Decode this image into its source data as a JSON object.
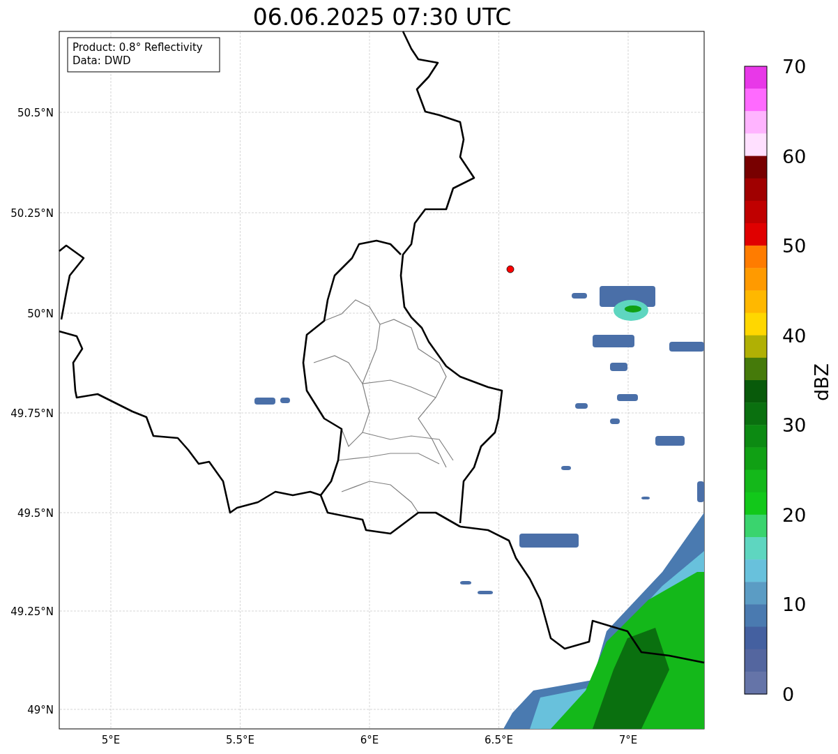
{
  "title": "06.06.2025 07:30 UTC",
  "info_box": {
    "lines": [
      "Product: 0.8° Reflectivity",
      "Data: DWD"
    ]
  },
  "lat_labels": [
    "50.5°N",
    "50.25°N",
    "50°N",
    "49.75°N",
    "49.5°N",
    "49.25°N",
    "49°N"
  ],
  "lon_labels": [
    "5°E",
    "5.5°E",
    "6°E",
    "6.5°E",
    "7°E"
  ],
  "colorbar": {
    "label": "dBZ",
    "ticks": [
      "70",
      "60",
      "50",
      "40",
      "30",
      "20",
      "10",
      "0"
    ],
    "segments": [
      {
        "color": "#e838e8"
      },
      {
        "color": "#ff6aff"
      },
      {
        "color": "#ffb4ff"
      },
      {
        "color": "#ffe0ff"
      },
      {
        "color": "#780000"
      },
      {
        "color": "#a00000"
      },
      {
        "color": "#c00000"
      },
      {
        "color": "#e00000"
      },
      {
        "color": "#ff7c00"
      },
      {
        "color": "#ff9a00"
      },
      {
        "color": "#ffb800"
      },
      {
        "color": "#ffd700"
      },
      {
        "color": "#b0b004"
      },
      {
        "color": "#457a0a"
      },
      {
        "color": "#085a0a"
      },
      {
        "color": "#0a700f"
      },
      {
        "color": "#0c8a12"
      },
      {
        "color": "#10a014"
      },
      {
        "color": "#14b81a"
      },
      {
        "color": "#12c81a"
      },
      {
        "color": "#3ad46e"
      },
      {
        "color": "#5ed6c0"
      },
      {
        "color": "#68c1dc"
      },
      {
        "color": "#5b9cc4"
      },
      {
        "color": "#4a7ab0"
      },
      {
        "color": "#4460a0"
      },
      {
        "color": "#54669f"
      },
      {
        "color": "#6574a8"
      }
    ]
  }
}
